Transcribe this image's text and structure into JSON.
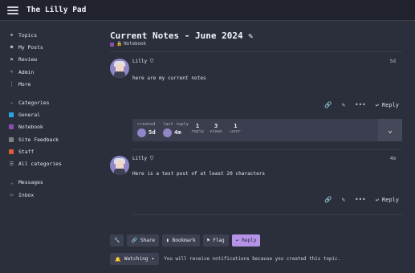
{
  "header": {
    "site_title": "The Lilly Pad",
    "menu_icon": "hamburger-icon"
  },
  "sidebar": {
    "items": [
      {
        "label": "Topics",
        "icon": "layers-icon"
      },
      {
        "label": "My Posts",
        "icon": "user-icon"
      },
      {
        "label": "Review",
        "icon": "flag-icon"
      },
      {
        "label": "Admin",
        "icon": "wrench-icon"
      },
      {
        "label": "More",
        "icon": "vertical-dots-icon"
      }
    ],
    "categories_heading": "Categories",
    "categories": [
      {
        "label": "General",
        "color": "#27a3e3"
      },
      {
        "label": "Notebook",
        "color": "#8a4eb2"
      },
      {
        "label": "Site Feedback",
        "color": "#808281"
      },
      {
        "label": "Staff",
        "color": "#e45735"
      },
      {
        "label": "All categories",
        "color": ""
      }
    ],
    "messages_heading": "Messages",
    "messages": [
      {
        "label": "Inbox"
      }
    ]
  },
  "topic": {
    "title": "Current Notes - June 2024",
    "category": "Notebook",
    "category_color": "#8a4eb2"
  },
  "posts": [
    {
      "username": "Lilly",
      "age": "5d",
      "text": "here are my current notes"
    },
    {
      "username": "Lilly",
      "age": "4m",
      "text": "Here is a test post of at least 20 characters"
    }
  ],
  "topic_meta": {
    "created_label": "created",
    "created_value": "5d",
    "last_reply_label": "last reply",
    "last_reply_value": "4m",
    "replies_value": "1",
    "replies_label": "reply",
    "views_value": "3",
    "views_label": "views",
    "users_value": "1",
    "users_label": "user"
  },
  "post_actions": {
    "reply_label": "Reply"
  },
  "footer_buttons": {
    "share": "Share",
    "bookmark": "Bookmark",
    "flag": "Flag",
    "reply": "Reply",
    "accent": "#b593e6"
  },
  "notifications": {
    "level": "Watching",
    "message": "You will receive notifications because you created this topic."
  }
}
